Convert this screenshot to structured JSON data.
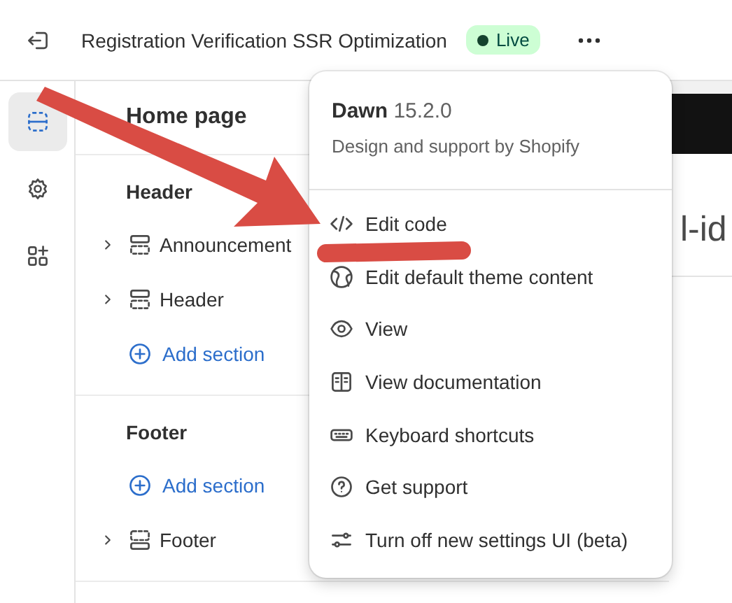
{
  "topbar": {
    "title": "Registration Verification SSR Optimization",
    "status": {
      "label": "Live",
      "kind": "success"
    }
  },
  "rail": [
    {
      "kind": "sections",
      "selected": true
    },
    {
      "kind": "settings",
      "selected": false
    },
    {
      "kind": "apps",
      "selected": false
    }
  ],
  "sidebar": {
    "title": "Home page",
    "groups": [
      {
        "title": "Header",
        "items": [
          {
            "kind": "section",
            "label": "Announcement"
          },
          {
            "kind": "section",
            "label": "Header"
          },
          {
            "kind": "add",
            "label": "Add section"
          }
        ]
      },
      {
        "title": "Footer",
        "items": [
          {
            "kind": "add",
            "label": "Add section"
          },
          {
            "kind": "footer",
            "label": "Footer"
          }
        ]
      }
    ]
  },
  "preview": {
    "heading": "l-id"
  },
  "menu": {
    "theme_name": "Dawn",
    "version": "15.2.0",
    "subtitle": "Design and support by Shopify",
    "items": [
      {
        "kind": "code",
        "label": "Edit code"
      },
      {
        "kind": "globe",
        "label": "Edit default theme content"
      },
      {
        "kind": "eye",
        "label": "View"
      },
      {
        "kind": "book",
        "label": "View documentation"
      },
      {
        "kind": "keyboard",
        "label": "Keyboard shortcuts"
      },
      {
        "kind": "help",
        "label": "Get support"
      },
      {
        "kind": "sliders",
        "label": "Turn off new settings UI (beta)"
      }
    ]
  }
}
